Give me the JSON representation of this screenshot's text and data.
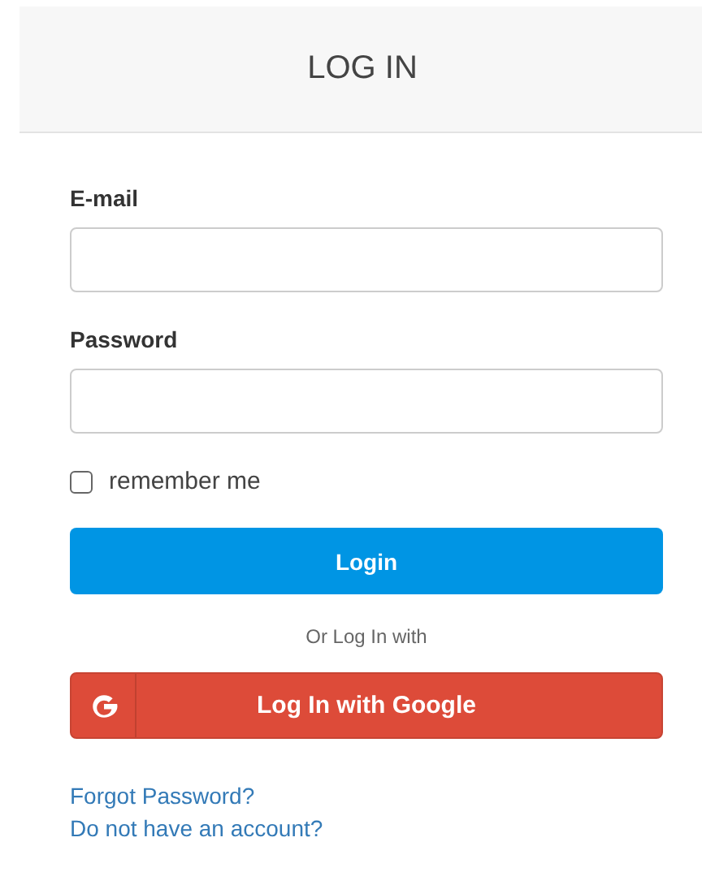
{
  "header": {
    "title": "LOG IN"
  },
  "fields": [
    {
      "label": "E-mail"
    },
    {
      "label": "Password"
    }
  ],
  "remember": {
    "label": "remember me",
    "checked": false
  },
  "login_button": "Login",
  "divider_text": "Or Log In with",
  "google_button": "Log In with Google",
  "links": [
    "Forgot Password?",
    "Do not have an account?"
  ]
}
